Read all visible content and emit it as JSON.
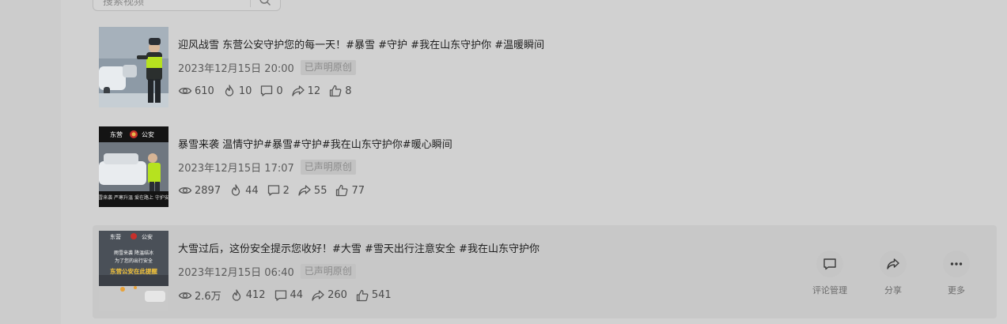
{
  "search": {
    "placeholder": "搜索视频"
  },
  "items": [
    {
      "title": "迎风战雪 东营公安守护您的每一天！#暴雪 #守护 #我在山东守护你 #温暖瞬间",
      "date": "2023年12月15日 20:00",
      "badge": "已声明原创",
      "stats": {
        "views": "610",
        "hot": "10",
        "comments": "0",
        "shares": "12",
        "likes": "8"
      }
    },
    {
      "title": "暴雪来袭 温情守护#暴雪#守护#我在山东守护你#暖心瞬间",
      "date": "2023年12月15日 17:07",
      "badge": "已声明原创",
      "thumb_text": {
        "top_left": "东营",
        "top_right": "公安",
        "bottom": "暴雪来袭 严寒升温 爱在路上 守护安全"
      },
      "stats": {
        "views": "2897",
        "hot": "44",
        "comments": "2",
        "shares": "55",
        "likes": "77"
      }
    },
    {
      "title": "大雪过后，这份安全提示您收好！#大雪 #雪天出行注意安全 #我在山东守护你",
      "date": "2023年12月15日 06:40",
      "badge": "已声明原创",
      "thumb_text": {
        "top_left": "东营",
        "top_right": "公安",
        "line1": "雨雪来袭 降温结冰",
        "line2": "为了您的出行安全",
        "line3": "东营公安在此提醒"
      },
      "stats": {
        "views": "2.6万",
        "hot": "412",
        "comments": "44",
        "shares": "260",
        "likes": "541"
      },
      "actions": [
        {
          "label": "评论管理",
          "icon": "comment-icon"
        },
        {
          "label": "分享",
          "icon": "share-icon"
        },
        {
          "label": "更多",
          "icon": "more-icon"
        }
      ]
    }
  ],
  "colors": {
    "background": "#cccccc",
    "panel": "#d1d1d1",
    "hover_row": "#c8c8c8",
    "badge_bg": "#c2c2c2"
  }
}
